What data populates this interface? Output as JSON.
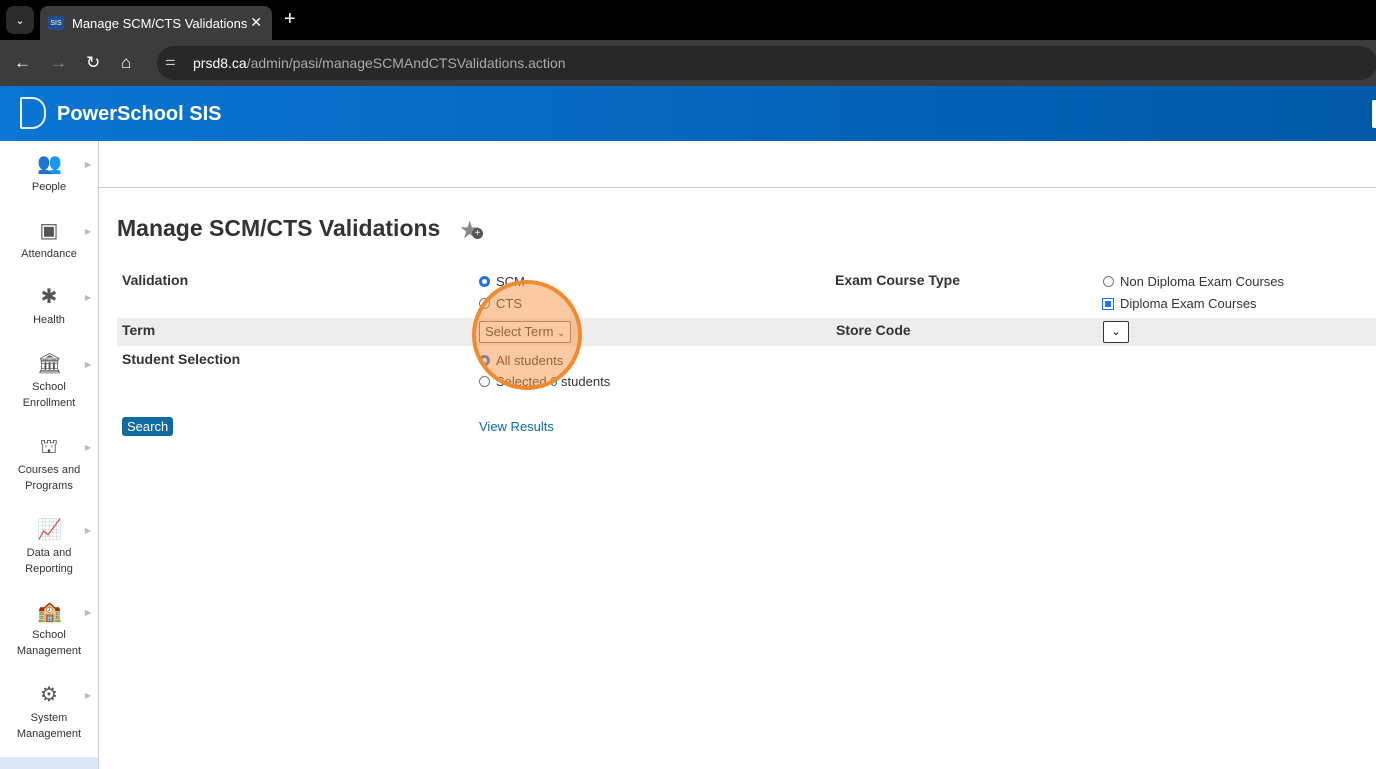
{
  "browser": {
    "tab_title": "Manage SCM/CTS Validations",
    "favicon_text": "SIS",
    "url_host": "prsd8.ca",
    "url_path": "/admin/pasi/manageSCMAndCTSValidations.action"
  },
  "app": {
    "brand": "PowerSchool SIS",
    "brand_color": "#0a75d4"
  },
  "sidebar": {
    "items": [
      {
        "label": "People",
        "icon": "people-icon"
      },
      {
        "label": "Attendance",
        "icon": "attendance-icon"
      },
      {
        "label": "Health",
        "icon": "health-icon"
      },
      {
        "label": "School Enrollment",
        "icon": "school-icon"
      },
      {
        "label": "Courses and Programs",
        "icon": "courses-icon"
      },
      {
        "label": "Data and Reporting",
        "icon": "chart-icon"
      },
      {
        "label": "School Management",
        "icon": "school-gear-icon"
      },
      {
        "label": "System Management",
        "icon": "gear-icon"
      }
    ]
  },
  "page": {
    "title": "Manage SCM/CTS Validations",
    "validation_label": "Validation",
    "validation_options": [
      "SCM",
      "CTS"
    ],
    "validation_selected": "SCM",
    "exam_type_label": "Exam Course Type",
    "exam_options": [
      "Non Diploma Exam Courses",
      "Diploma Exam Courses"
    ],
    "exam_selected": "Diploma Exam Courses",
    "term_label": "Term",
    "term_value": "Select Term",
    "store_code_label": "Store Code",
    "store_code_value": "",
    "student_selection_label": "Student Selection",
    "student_all": "All students",
    "student_selected_prefix": "Selected ",
    "student_selected_count": "0",
    "student_selected_suffix": " students",
    "search_button": "Search",
    "view_results": "View Results"
  }
}
